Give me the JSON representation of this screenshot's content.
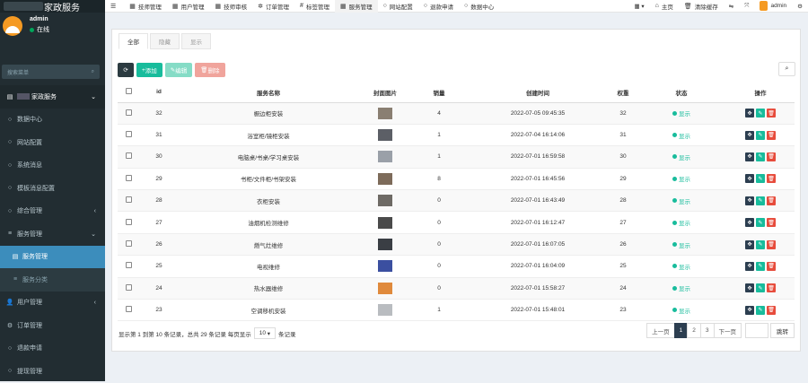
{
  "brand": {
    "title": "家政服务"
  },
  "user": {
    "name": "admin",
    "status": "在线"
  },
  "sidebar_search": {
    "placeholder": "搜索菜单"
  },
  "sidebar": {
    "items": [
      {
        "label": "家政服务",
        "icon": "grid-icon",
        "active": true
      },
      {
        "label": "数据中心",
        "icon": "circle-icon"
      },
      {
        "label": "网站配置",
        "icon": "circle-icon"
      },
      {
        "label": "系统消息",
        "icon": "circle-icon"
      },
      {
        "label": "模板消息配置",
        "icon": "circle-icon"
      },
      {
        "label": "综合管理",
        "icon": "circle-icon"
      },
      {
        "label": "服务管理",
        "icon": "list-icon"
      },
      {
        "label": "服务管理",
        "icon": "grid-icon",
        "current": true
      },
      {
        "label": "服务分类",
        "icon": "list-icon"
      },
      {
        "label": "用户管理",
        "icon": "users-icon"
      },
      {
        "label": "订单管理",
        "icon": "gear-icon"
      },
      {
        "label": "退款申请",
        "icon": "circle-icon"
      },
      {
        "label": "提现管理",
        "icon": "circle-icon"
      }
    ]
  },
  "topnav": [
    {
      "label": "技师管理",
      "glyph": "▦"
    },
    {
      "label": "用户管理",
      "glyph": "▦"
    },
    {
      "label": "技师审核",
      "glyph": "▦"
    },
    {
      "label": "订单管理",
      "glyph": "✲"
    },
    {
      "label": "标签管理",
      "glyph": "#"
    },
    {
      "label": "服务管理",
      "glyph": "▦"
    },
    {
      "label": "网站配置",
      "glyph": "○"
    },
    {
      "label": "退款申请",
      "glyph": "○"
    },
    {
      "label": "数据中心",
      "glyph": "○"
    }
  ],
  "topright": {
    "home": "主页",
    "clear": "清除缓存",
    "user": "admin"
  },
  "tabs": [
    "全部",
    "隐藏",
    "显示"
  ],
  "toolbar": {
    "add": "添加",
    "edit": "编辑",
    "delete": "删除"
  },
  "table": {
    "headers": [
      "id",
      "服务名称",
      "封面图片",
      "销量",
      "创建时间",
      "权重",
      "状态",
      "操作"
    ],
    "rows": [
      {
        "id": "32",
        "name": "橱边柜安装",
        "sales": "4",
        "time": "2022-07-05 09:45:35",
        "weight": "32",
        "status": "显示",
        "thumb": "#8a7f72"
      },
      {
        "id": "31",
        "name": "浴室柜/镜柜安装",
        "sales": "1",
        "time": "2022-07-04 16:14:06",
        "weight": "31",
        "status": "显示",
        "thumb": "#5c5f66"
      },
      {
        "id": "30",
        "name": "电脑桌/书桌/学习桌安装",
        "sales": "1",
        "time": "2022-07-01 16:59:58",
        "weight": "30",
        "status": "显示",
        "thumb": "#9aa0a8"
      },
      {
        "id": "29",
        "name": "书柜/文件柜/书架安装",
        "sales": "8",
        "time": "2022-07-01 16:45:56",
        "weight": "29",
        "status": "显示",
        "thumb": "#7d6b5a"
      },
      {
        "id": "28",
        "name": "衣柜安装",
        "sales": "0",
        "time": "2022-07-01 16:43:49",
        "weight": "28",
        "status": "显示",
        "thumb": "#6e6a65"
      },
      {
        "id": "27",
        "name": "油烟机检测维修",
        "sales": "0",
        "time": "2022-07-01 16:12:47",
        "weight": "27",
        "status": "显示",
        "thumb": "#4a4a4a"
      },
      {
        "id": "26",
        "name": "燃气灶维修",
        "sales": "0",
        "time": "2022-07-01 16:07:05",
        "weight": "26",
        "status": "显示",
        "thumb": "#3a3e44"
      },
      {
        "id": "25",
        "name": "电视维修",
        "sales": "0",
        "time": "2022-07-01 16:04:09",
        "weight": "25",
        "status": "显示",
        "thumb": "#3b4fa0"
      },
      {
        "id": "24",
        "name": "热水器维修",
        "sales": "0",
        "time": "2022-07-01 15:58:27",
        "weight": "24",
        "status": "显示",
        "thumb": "#e08a3c"
      },
      {
        "id": "23",
        "name": "空调移机安装",
        "sales": "1",
        "time": "2022-07-01 15:48:01",
        "weight": "23",
        "status": "显示",
        "thumb": "#b9bcc0"
      }
    ]
  },
  "footer": {
    "summary": "显示第 1 到第 10 条记录，总共 29 条记录 每页显示",
    "per_page": "10",
    "records": "条记录"
  },
  "pager": {
    "prev": "上一页",
    "pages": [
      "1",
      "2",
      "3"
    ],
    "next": "下一页",
    "jump": "跳转"
  },
  "colors": {
    "sidebar": "#222d32",
    "accent": "#3c8dbc",
    "success": "#18bc9c",
    "danger": "#e74c3c"
  }
}
